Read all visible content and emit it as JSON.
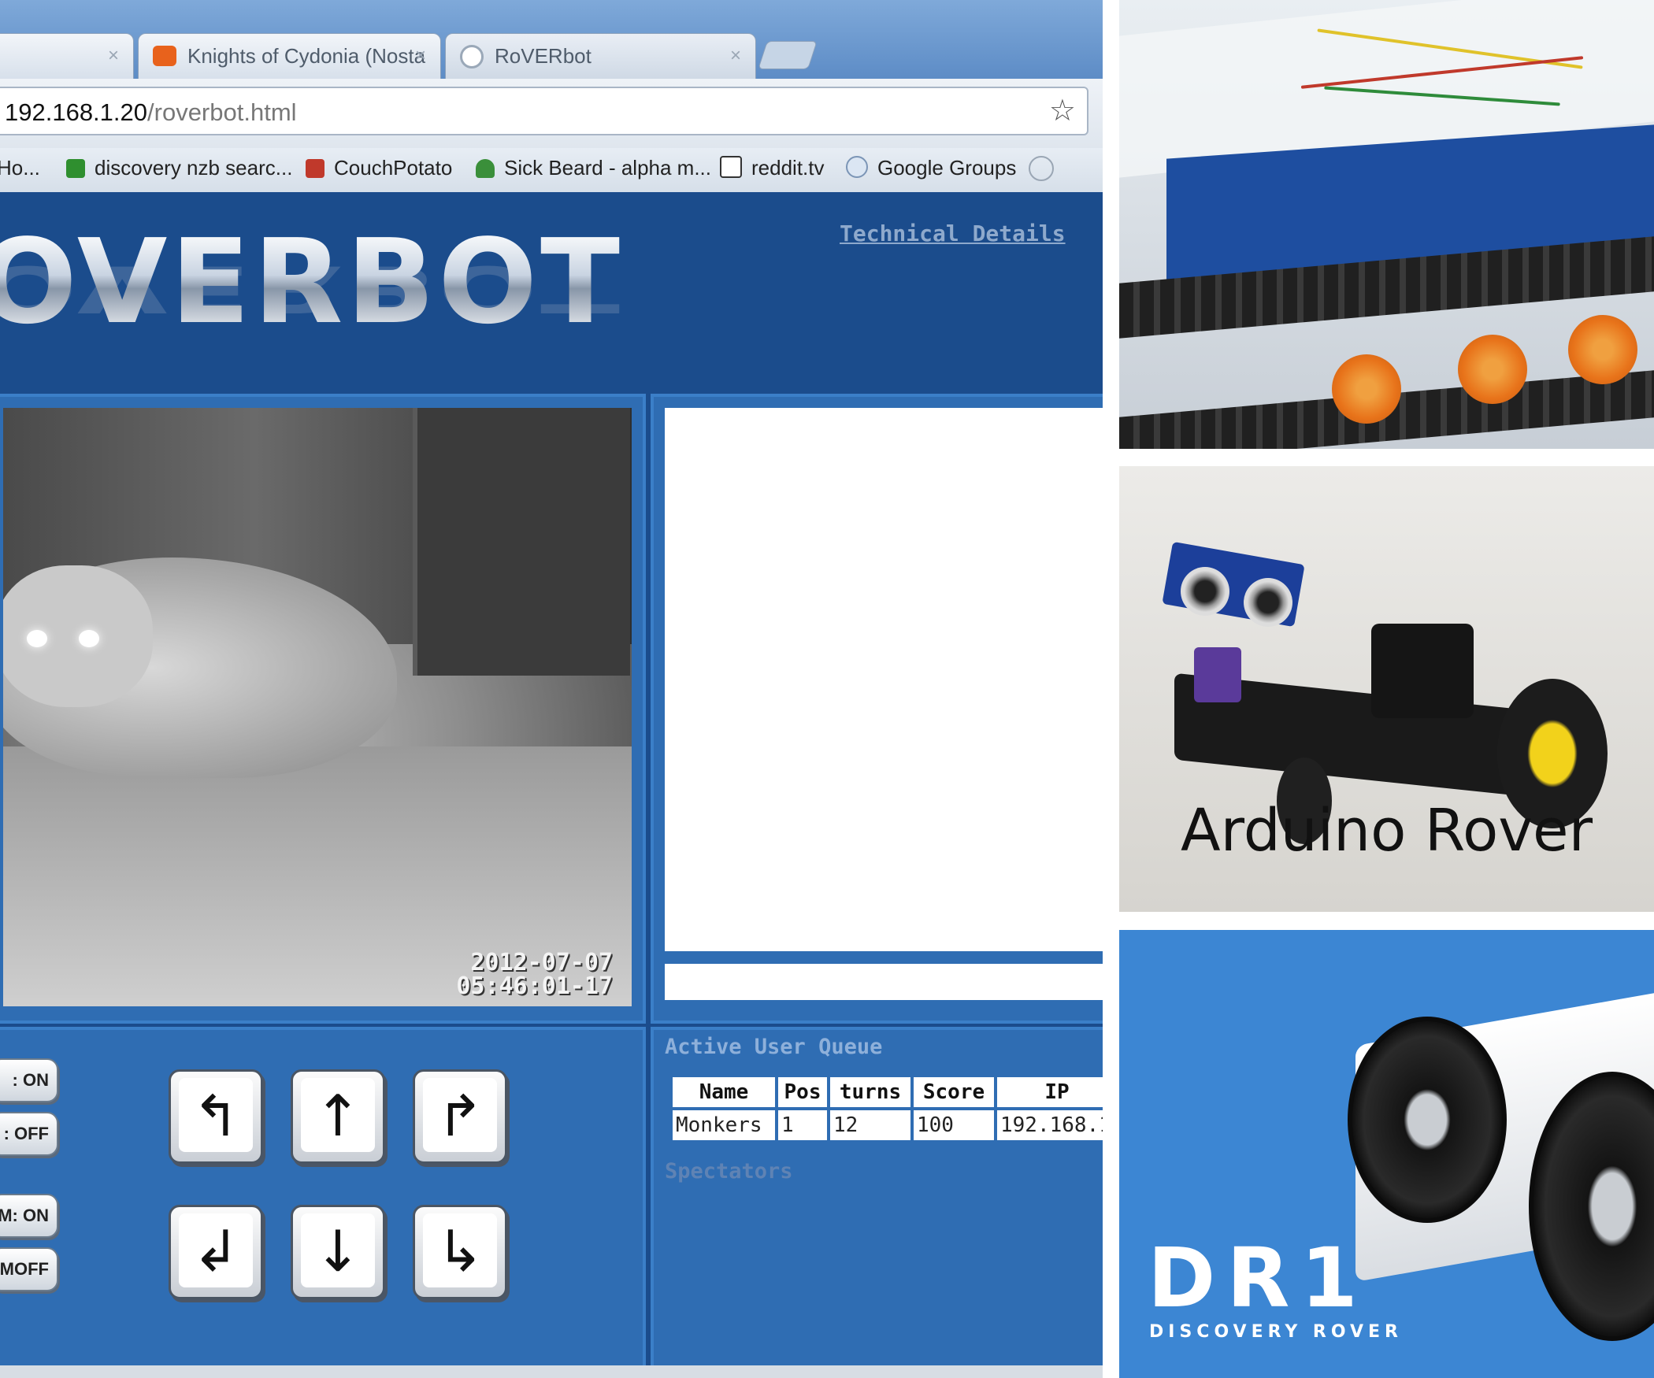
{
  "browser": {
    "tabs": [
      {
        "label": ""
      },
      {
        "label": "Knights of Cydonia (Nosta"
      },
      {
        "label": "RoVERbot"
      }
    ],
    "tab_close_glyph": "×",
    "address": {
      "host": "192.168.1.20",
      "path": "/roverbot.html"
    },
    "bookmarks": [
      {
        "label": "Ho..."
      },
      {
        "label": "discovery nzb searc..."
      },
      {
        "label": "CouchPotato"
      },
      {
        "label": "Sick Beard - alpha m..."
      },
      {
        "label": "reddit.tv"
      },
      {
        "label": "Google Groups"
      }
    ]
  },
  "page": {
    "logo": "OVERBOT",
    "tech_link": "Technical Details",
    "video": {
      "timestamp_date": "2012-07-07",
      "timestamp_time": "05:46:01-17"
    },
    "toggles": [
      ": ON",
      ": OFF",
      "M: ON",
      "MOFF"
    ],
    "arrows": {
      "turn_left": "↰",
      "forward": "↑",
      "turn_right": "↱",
      "back_left": "↲",
      "backward": "↓",
      "back_right": "↳"
    },
    "queue": {
      "title": "Active User Queue",
      "columns": [
        "Name",
        "Pos",
        "turns",
        "Score",
        "IP"
      ],
      "rows": [
        [
          "Monkers",
          "1",
          "12",
          "100",
          "192.168.1"
        ]
      ]
    },
    "spectators_label": "Spectators"
  },
  "photos": {
    "arduino_caption": "Arduino Rover",
    "dr1_logo": "DR1",
    "dr1_subtitle": "DISCOVERY ROVER"
  },
  "colors": {
    "page_bg": "#1b4c8c",
    "panel_bg": "#2f6db3",
    "dr1_bg": "#3c86d3"
  }
}
